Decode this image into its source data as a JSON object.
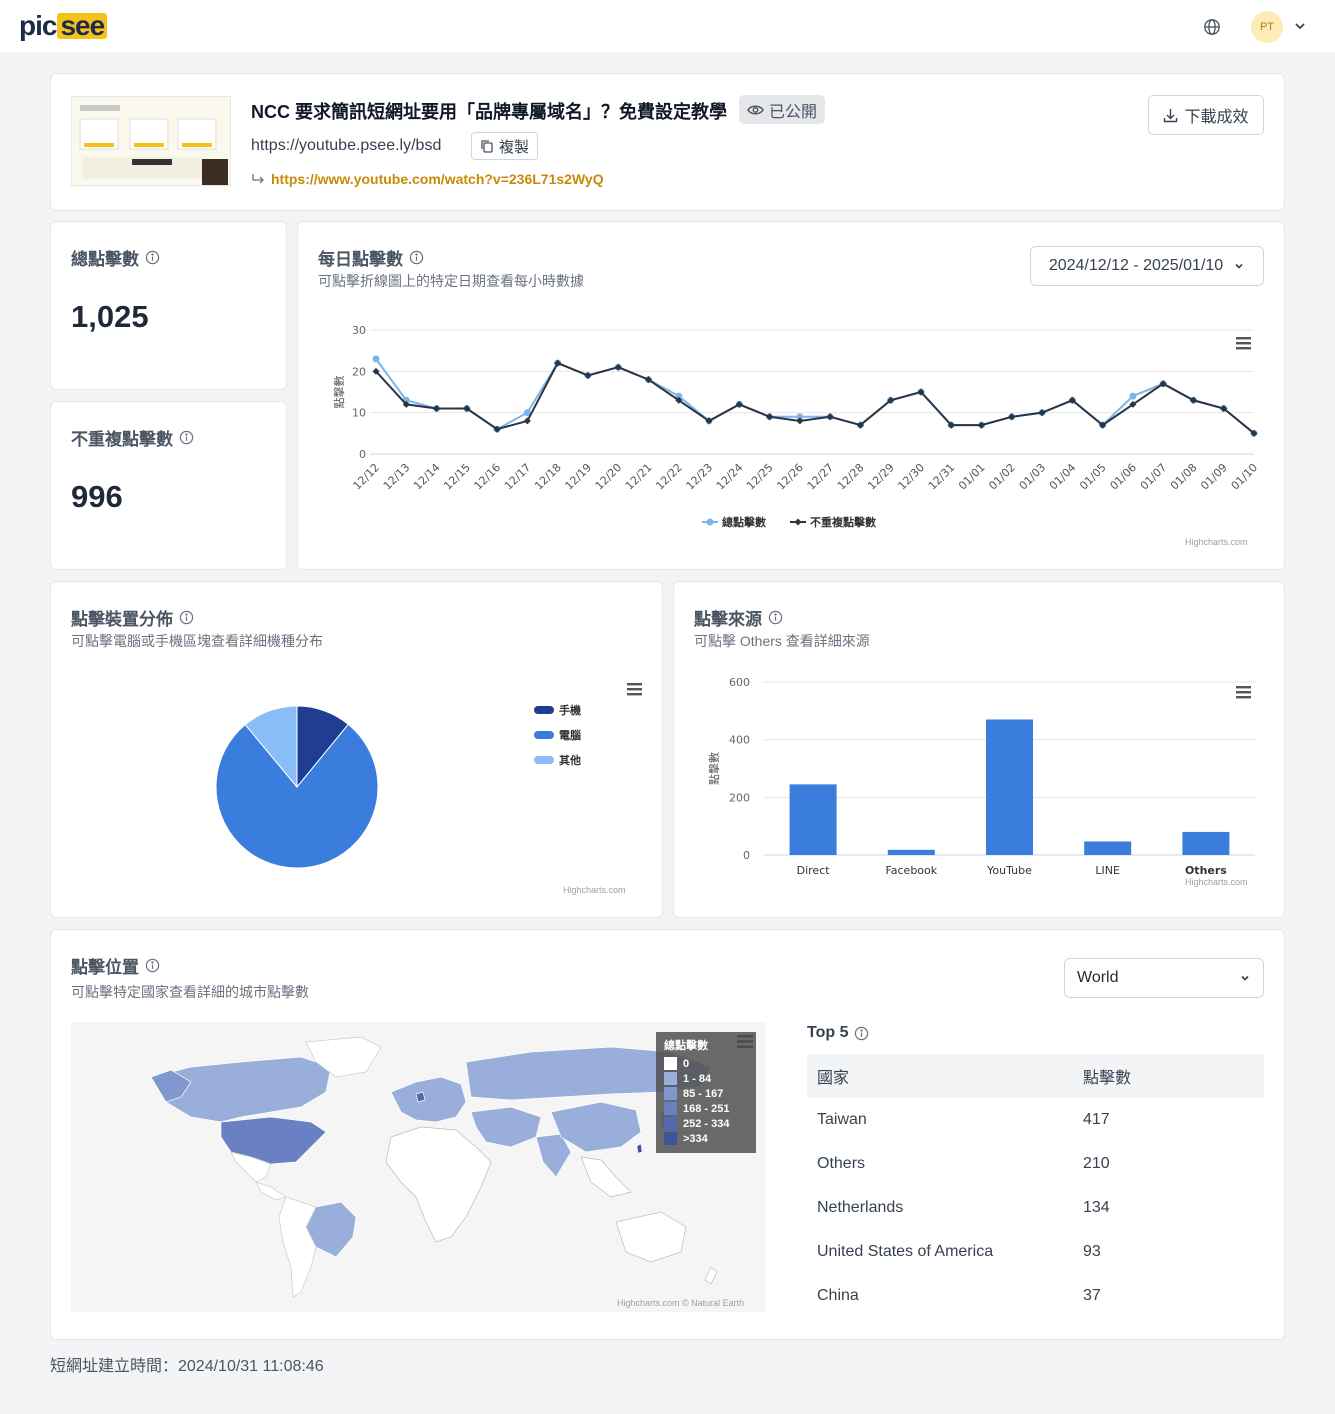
{
  "header": {
    "logo_part1": "pic",
    "logo_part2": "see",
    "avatar_initials": "PT"
  },
  "link": {
    "title": "NCC 要求簡訊短網址要用「品牌專屬域名」？免費設定教學",
    "visibility": "已公開",
    "short_url": "https://youtube.psee.ly/bsd",
    "copy_label": "複製",
    "target_url": "https://www.youtube.com/watch?v=236L71s2WyQ",
    "download_label": "下載成效"
  },
  "stats": {
    "total_label": "總點擊數",
    "total_value": "1,025",
    "unique_label": "不重複點擊數",
    "unique_value": "996"
  },
  "daily": {
    "title": "每日點擊數",
    "subtitle": "可點擊折線圖上的特定日期查看每小時數據",
    "date_range": "2024/12/12 - 2025/01/10",
    "credit": "Highcharts.com"
  },
  "device": {
    "title": "點擊裝置分佈",
    "subtitle": "可點擊電腦或手機區塊查看詳細機種分布",
    "credit": "Highcharts.com"
  },
  "source": {
    "title": "點擊來源",
    "subtitle": "可點擊 Others 查看詳細來源",
    "credit": "Highcharts.com"
  },
  "location": {
    "title": "點擊位置",
    "subtitle": "可點擊特定國家查看詳細的城市點擊數",
    "region_select": "World",
    "map_credit": "Highcharts.com © Natural Earth",
    "legend_title": "總點擊數",
    "legend": [
      {
        "label": "0",
        "color": "#ffffff"
      },
      {
        "label": "1 - 84",
        "color": "#9aaedb"
      },
      {
        "label": "85 - 167",
        "color": "#8098cf"
      },
      {
        "label": "168 - 251",
        "color": "#6980c2"
      },
      {
        "label": "252 - 334",
        "color": "#5169b0"
      },
      {
        "label": ">334",
        "color": "#3c549c"
      }
    ],
    "top5_title": "Top 5",
    "top5_headers": [
      "國家",
      "點擊數"
    ],
    "top5": [
      {
        "country": "Taiwan",
        "clicks": "417"
      },
      {
        "country": "Others",
        "clicks": "210"
      },
      {
        "country": "Netherlands",
        "clicks": "134"
      },
      {
        "country": "United States of America",
        "clicks": "93"
      },
      {
        "country": "China",
        "clicks": "37"
      }
    ]
  },
  "footer": {
    "created": "短網址建立時間：2024/10/31 11:08:46"
  },
  "colors": {
    "accent_blue": "#3b7ddd",
    "dark_series": "#2b3442",
    "light_series": "#7cb5ec",
    "brand_yellow": "#f6c21a"
  },
  "chart_data": [
    {
      "type": "line",
      "ylabel": "點擊數",
      "ylim": [
        0,
        30
      ],
      "yticks": [
        0,
        10,
        20,
        30
      ],
      "categories": [
        "12/12",
        "12/13",
        "12/14",
        "12/15",
        "12/16",
        "12/17",
        "12/18",
        "12/19",
        "12/20",
        "12/21",
        "12/22",
        "12/23",
        "12/24",
        "12/25",
        "12/26",
        "12/27",
        "12/28",
        "12/29",
        "12/30",
        "12/31",
        "01/01",
        "01/02",
        "01/03",
        "01/04",
        "01/05",
        "01/06",
        "01/07",
        "01/08",
        "01/09",
        "01/10"
      ],
      "series": [
        {
          "name": "總點擊數",
          "color": "#7cb5ec",
          "values": [
            23,
            13,
            11,
            11,
            6,
            10,
            22,
            19,
            21,
            18,
            14,
            8,
            12,
            9,
            9,
            9,
            7,
            13,
            15,
            7,
            7,
            9,
            10,
            13,
            7,
            14,
            17,
            13,
            11,
            5
          ]
        },
        {
          "name": "不重複點擊數",
          "color": "#2b3442",
          "values": [
            20,
            12,
            11,
            11,
            6,
            8,
            22,
            19,
            21,
            18,
            13,
            8,
            12,
            9,
            8,
            9,
            7,
            13,
            15,
            7,
            7,
            9,
            10,
            13,
            7,
            12,
            17,
            13,
            11,
            5
          ]
        }
      ],
      "legend": "bottom-center"
    },
    {
      "type": "pie",
      "categories": [
        "手機",
        "電腦",
        "其他"
      ],
      "values": [
        112,
        800,
        113
      ],
      "colors": [
        "#1f3e91",
        "#3b7ddd",
        "#88bdf7"
      ],
      "legend": "right"
    },
    {
      "type": "bar",
      "categories": [
        "Direct",
        "Facebook",
        "YouTube",
        "LINE",
        "Others"
      ],
      "values": [
        245,
        18,
        470,
        47,
        80
      ],
      "ylabel": "點擊數",
      "ylim": [
        0,
        600
      ],
      "yticks": [
        0,
        200,
        400,
        600
      ],
      "color": "#3b7ddd"
    }
  ]
}
